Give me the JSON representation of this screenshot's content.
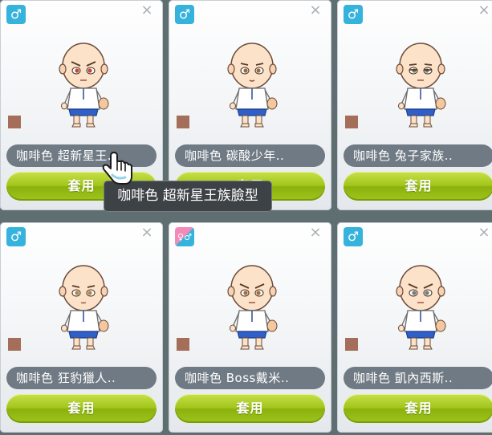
{
  "cards": [
    {
      "gender": "male",
      "gender_symbol": "♂",
      "close_symbol": "×",
      "name": "咖啡色 超新星王..",
      "apply_label": "套用",
      "color_swatch": "#a46e5a",
      "eye_color": "#c8462e",
      "face": "scowl"
    },
    {
      "gender": "male",
      "gender_symbol": "♂",
      "close_symbol": "×",
      "name": "咖啡色 碳酸少年..",
      "apply_label": "套用",
      "color_swatch": "#a46e5a",
      "eye_color": "#9a6a3a",
      "face": "pout"
    },
    {
      "gender": "male",
      "gender_symbol": "♂",
      "close_symbol": "×",
      "name": "咖啡色 兔子家族..",
      "apply_label": "套用",
      "color_swatch": "#a46e5a",
      "eye_color": "#8a7a5a",
      "face": "sleepy"
    },
    {
      "gender": "male",
      "gender_symbol": "♂",
      "close_symbol": "×",
      "name": "咖啡色 狂豹獵人..",
      "apply_label": "套用",
      "color_swatch": "#a46e5a",
      "eye_color": "#b8843a",
      "face": "calm"
    },
    {
      "gender": "unisex",
      "gender_symbol": "♀♂",
      "close_symbol": "×",
      "name": "咖啡色 Boss戴米..",
      "apply_label": "套用",
      "color_swatch": "#a46e5a",
      "eye_color": "#b06a30",
      "face": "angry"
    },
    {
      "gender": "male",
      "gender_symbol": "♂",
      "close_symbol": "×",
      "name": "咖啡色 凱內西斯..",
      "apply_label": "套用",
      "color_swatch": "#a46e5a",
      "eye_color": "#7f7a6e",
      "face": "stern"
    }
  ],
  "tooltip": {
    "text": "咖啡色 超新星王族臉型"
  },
  "colors": {
    "card_bg": "#f2f4f6",
    "name_bar": "#6f7a84",
    "apply_button": "#a2c51a",
    "male_badge": "#36b3dc",
    "female_badge": "#f28bb8",
    "tooltip_bg": "#3d4247",
    "page_bg": "#5f6e70"
  }
}
